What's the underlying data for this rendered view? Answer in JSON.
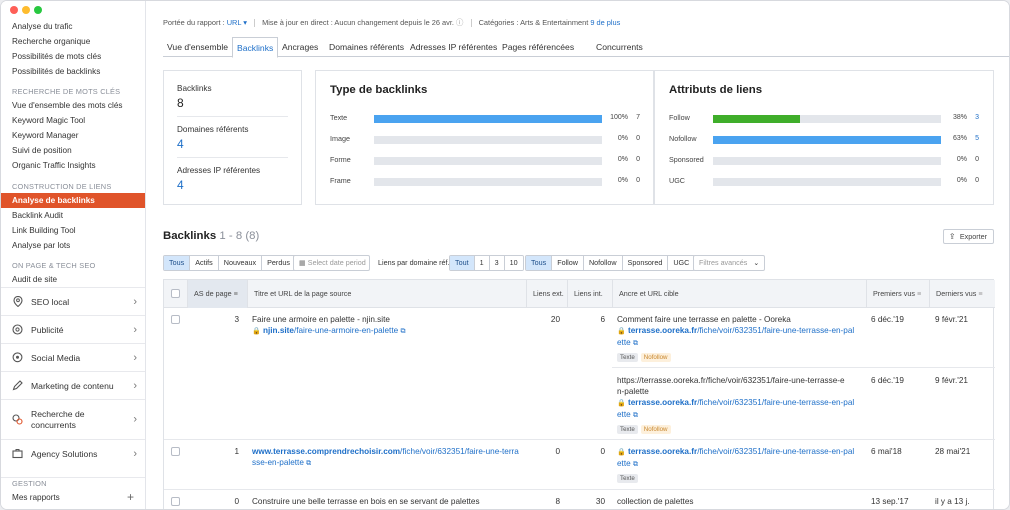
{
  "window": {
    "dot_colors": [
      "#fe5f57",
      "#febc2e",
      "#28c840"
    ]
  },
  "sidebar": {
    "group1": [
      "Analyse du trafic",
      "Recherche organique",
      "Possibilités de mots clés",
      "Possibilités de backlinks"
    ],
    "section_keywords": "RECHERCHE DE MOTS CLÉS",
    "group2": [
      "Vue d'ensemble des mots clés",
      "Keyword Magic Tool",
      "Keyword Manager",
      "Suivi de position",
      "Organic Traffic Insights"
    ],
    "section_links": "CONSTRUCTION DE LIENS",
    "group3": [
      "Analyse de backlinks",
      "Backlink Audit",
      "Link Building Tool",
      "Analyse par lots"
    ],
    "section_onpage": "ON PAGE & TECH SEO",
    "group4": [
      "Audit de site"
    ],
    "big_items": [
      "SEO local",
      "Publicité",
      "Social Media",
      "Marketing de contenu",
      "Recherche de concurrents",
      "Agency Solutions"
    ],
    "section_gestion": "GESTION",
    "my_reports": "Mes rapports",
    "active_color": "#e0542a"
  },
  "infobar": {
    "scope_label": "Portée du rapport :",
    "scope_value": "URL",
    "update_text": "Mise à jour en direct : Aucun changement depuis le 26 avr.",
    "categories_label": "Catégories : Arts & Entertainment",
    "categories_more": "9 de plus"
  },
  "tabs": [
    "Vue d'ensemble",
    "Backlinks",
    "Ancrages",
    "Domaines référents",
    "Adresses IP référentes",
    "Pages référencées",
    "Concurrents"
  ],
  "kpis": {
    "backlinks_label": "Backlinks",
    "backlinks_value": "8",
    "domains_label": "Domaines référents",
    "domains_value": "4",
    "ips_label": "Adresses IP référentes",
    "ips_value": "4"
  },
  "type_panel": {
    "title": "Type de backlinks",
    "rows": [
      {
        "label": "Texte",
        "fraction": 1.0,
        "pct": "100%",
        "count": "7"
      },
      {
        "label": "Image",
        "fraction": 0,
        "pct": "0%",
        "count": "0"
      },
      {
        "label": "Forme",
        "fraction": 0,
        "pct": "0%",
        "count": "0"
      },
      {
        "label": "Frame",
        "fraction": 0,
        "pct": "0%",
        "count": "0"
      }
    ],
    "bar_color": "#4aa3f0"
  },
  "attr_panel": {
    "title": "Attributs de liens",
    "rows": [
      {
        "label": "Follow",
        "fraction": 0.38,
        "pct": "38%",
        "count": "3",
        "color": "#3fae2a"
      },
      {
        "label": "Nofollow",
        "fraction": 1.0,
        "pct": "63%",
        "count": "5",
        "color": "#4aa3f0"
      },
      {
        "label": "Sponsored",
        "fraction": 0,
        "pct": "0%",
        "count": "0",
        "color": "#4aa3f0"
      },
      {
        "label": "UGC",
        "fraction": 0,
        "pct": "0%",
        "count": "0",
        "color": "#4aa3f0"
      }
    ]
  },
  "backlinks_section": {
    "title": "Backlinks",
    "range": "1 - 8 (8)",
    "export_label": "Exporter"
  },
  "filters": {
    "status": [
      "Tous",
      "Actifs",
      "Nouveaux",
      "Perdus"
    ],
    "date_placeholder": "Select date period",
    "per_domain_label": "Liens par domaine réf.",
    "per_domain": [
      "Tout",
      "1",
      "3",
      "10"
    ],
    "link_types": [
      "Tous",
      "Follow",
      "Nofollow",
      "Sponsored",
      "UGC"
    ],
    "advanced": "Filtres avancés"
  },
  "table": {
    "headers": [
      "AS de page",
      "Titre et URL de la page source",
      "Liens ext.",
      "Liens int.",
      "Ancre et URL cible",
      "Premiers vus",
      "Derniers vus"
    ],
    "rows": [
      {
        "as": "3",
        "title": "Faire une armoire en palette - njin.site",
        "src_host": "njin.site",
        "src_path": "/faire-une-armoire-en-palette",
        "ext": "20",
        "int": "6",
        "anchors": [
          {
            "anchor": "Comment faire une terrasse en palette - Ooreka",
            "t_host": "terrasse.ooreka.fr",
            "t_path1": "/fiche/voir/632351/faire-une-terrasse-en-pal",
            "t_path2": "ette",
            "tag1": "Texte",
            "tag2": "Nofollow",
            "first": "6 déc.'19",
            "last": "9 févr.'21"
          },
          {
            "anchor": "https://terrasse.ooreka.fr/fiche/voir/632351/faire-une-terrasse-e",
            "anchor2": "n-palette",
            "t_host": "terrasse.ooreka.fr",
            "t_path1": "/fiche/voir/632351/faire-une-terrasse-en-pal",
            "t_path2": "ette",
            "tag1": "Texte",
            "tag2": "Nofollow",
            "first": "6 déc.'19",
            "last": "9 févr.'21"
          }
        ]
      },
      {
        "as": "1",
        "src_host": "www.terrasse.comprendrechoisir.com",
        "src_path1": "/fiche/voir/632351/faire-une-terra",
        "src_path2": "sse-en-palette",
        "ext": "0",
        "int": "0",
        "t_host": "terrasse.ooreka.fr",
        "t_path1": "/fiche/voir/632351/faire-une-terrasse-en-pal",
        "t_path2": "ette",
        "tag1": "Texte",
        "first": "6 mai'18",
        "last": "28 mai'21"
      },
      {
        "as": "0",
        "title": "Construire une belle terrasse en bois en se servant de palettes",
        "ext": "8",
        "int": "30",
        "anchor": "collection de palettes",
        "first": "13 sep.'17",
        "last": "il y a 13 j."
      }
    ]
  }
}
